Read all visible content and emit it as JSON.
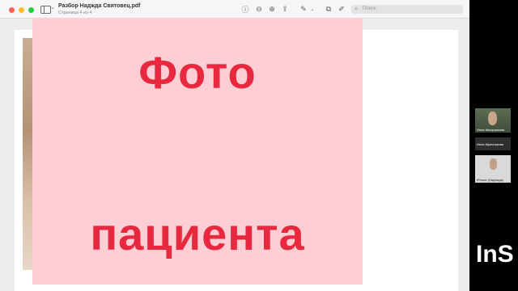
{
  "pdf_window": {
    "title": "Разбор Наджда Святовец.pdf",
    "page_indicator": "Страница 4 из 4",
    "search": {
      "placeholder": "Поиск"
    },
    "toolbar_icons": [
      "info-icon",
      "zoom-out-icon",
      "zoom-in-icon",
      "share-icon",
      "markup-icon",
      "rotate-icon",
      "annotate-icon",
      "circle-a-icon",
      "search-icon"
    ]
  },
  "slide": {
    "placeholder_line1": "Фото",
    "placeholder_line2": "пациента"
  },
  "call_panel": {
    "participants": [
      {
        "name": "Инна Мещерякова"
      },
      {
        "name": "Инна Мрачникова"
      },
      {
        "name": "iPhone (Надежда)"
      }
    ]
  },
  "watermark": {
    "text": "InS"
  },
  "colors": {
    "accent_red": "#e8283e",
    "placeholder_bg": "#fdced3"
  }
}
